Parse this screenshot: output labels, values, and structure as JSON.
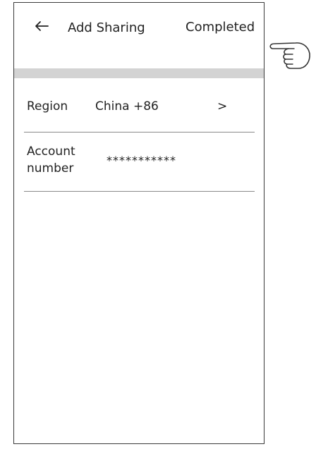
{
  "header": {
    "back_icon": "left-arrow-icon",
    "title": "Add Sharing",
    "completed_label": "Completed"
  },
  "form": {
    "region": {
      "label": "Region",
      "value": "China +86",
      "chevron": ">"
    },
    "account": {
      "label": "Account number",
      "value": "***********"
    }
  },
  "annotation": {
    "icon": "pointing-hand-icon"
  },
  "colors": {
    "background": "#ffffff",
    "border": "#3a3a3a",
    "separator_band": "#d3d3d3",
    "divider": "#8a8a8a",
    "text": "#222222"
  }
}
